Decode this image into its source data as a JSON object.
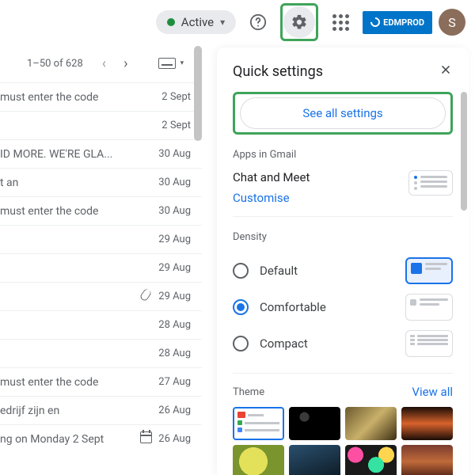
{
  "topbar": {
    "status_label": "Active",
    "brand": "EDMPROD",
    "avatar_initial": "S"
  },
  "list": {
    "pagination": "1–50 of 628",
    "rows": [
      {
        "subject": "must enter the code",
        "date": "2 Sept",
        "icon": ""
      },
      {
        "subject": "",
        "date": "2 Sept",
        "icon": ""
      },
      {
        "subject": "ID MORE. WE'RE GLA...",
        "date": "30 Aug",
        "icon": ""
      },
      {
        "subject": "t an",
        "date": "30 Aug",
        "icon": ""
      },
      {
        "subject": "must enter the code",
        "date": "30 Aug",
        "icon": ""
      },
      {
        "subject": "",
        "date": "29 Aug",
        "icon": ""
      },
      {
        "subject": "",
        "date": "29 Aug",
        "icon": ""
      },
      {
        "subject": "",
        "date": "29 Aug",
        "icon": "attachment"
      },
      {
        "subject": "",
        "date": "28 Aug",
        "icon": ""
      },
      {
        "subject": "",
        "date": "28 Aug",
        "icon": ""
      },
      {
        "subject": "must enter the code",
        "date": "27 Aug",
        "icon": ""
      },
      {
        "subject": "edrijf zijn en",
        "date": "26 Aug",
        "icon": ""
      },
      {
        "subject": "ng on Monday 2 Sept",
        "date": "26 Aug",
        "icon": "calendar"
      }
    ]
  },
  "panel": {
    "title": "Quick settings",
    "see_all": "See all settings",
    "apps_label": "Apps in Gmail",
    "chat_meet": "Chat and Meet",
    "customise": "Customise",
    "density_label": "Density",
    "density_options": {
      "default": "Default",
      "comfortable": "Comfortable",
      "compact": "Compact"
    },
    "density_selected": "comfortable",
    "theme_label": "Theme",
    "view_all": "View all"
  }
}
